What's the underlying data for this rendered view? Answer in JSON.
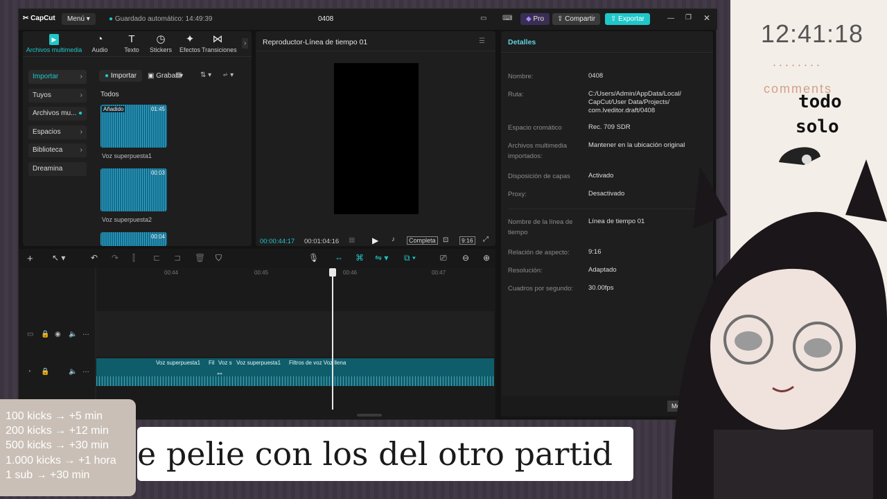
{
  "app": {
    "logo": "CapCut",
    "menu": "Menú",
    "autosave": "Guardado automático: 14:49:39",
    "project_title": "0408",
    "pro": "Pro",
    "share": "Compartir",
    "export": "Exportar"
  },
  "tools": [
    {
      "label": "Archivos multimedia",
      "icon": "media-icon"
    },
    {
      "label": "Audio",
      "icon": "audio-icon"
    },
    {
      "label": "Texto",
      "icon": "text-icon"
    },
    {
      "label": "Stickers",
      "icon": "sticker-icon"
    },
    {
      "label": "Efectos",
      "icon": "effects-icon"
    },
    {
      "label": "Transiciones",
      "icon": "transitions-icon"
    }
  ],
  "sidebar": {
    "items": [
      {
        "label": "Importar"
      },
      {
        "label": "Tuyos"
      },
      {
        "label": "Archivos mu..."
      },
      {
        "label": "Espacios"
      },
      {
        "label": "Biblioteca"
      },
      {
        "label": "Dreamina"
      }
    ]
  },
  "media_panel": {
    "import": "Importar",
    "record": "Grabar",
    "all": "Todos",
    "items": [
      {
        "name": "Voz superpuesta1",
        "badge": "Añadido",
        "duration": "01:45"
      },
      {
        "name": "Voz superpuesta2",
        "badge": "",
        "duration": "00:03"
      },
      {
        "name": "",
        "badge": "",
        "duration": "00:04"
      }
    ]
  },
  "player": {
    "title": "Reproductor-Línea de tiempo 01",
    "current_time": "00:00:44:17",
    "total_time": "00:01:04:16",
    "full_label": "Completa",
    "ratio_label": "9:16"
  },
  "details": {
    "title": "Detalles",
    "rows": [
      {
        "k": "Nombre:",
        "v": "0408"
      },
      {
        "k": "Ruta:",
        "v": "C:/Users/Admin/AppData/Local/\nCapCut/User Data/Projects/\ncom.lveditor.draft/0408"
      },
      {
        "k": "Espacio cromático",
        "v": "Rec. 709 SDR"
      },
      {
        "k": "Archivos multimedia\nimportados:",
        "v": "Mantener en la ubicación original"
      },
      {
        "k": "Disposición de capas",
        "v": "Activado"
      },
      {
        "k": "Proxy:",
        "v": "Desactivado"
      },
      {
        "k": "Nombre de la línea de\ntiempo",
        "v": "Línea de tiempo 01"
      },
      {
        "k": "Relación de aspecto:",
        "v": "9:16"
      },
      {
        "k": "Resolución:",
        "v": "Adaptado"
      },
      {
        "k": "Cuadros por segundo:",
        "v": "30.00fps"
      }
    ],
    "modify": "Modi"
  },
  "timeline": {
    "ruler": [
      "00:44",
      "00:45",
      "00:46",
      "00:47"
    ],
    "clip_labels": [
      "Voz superpuesta1",
      "Fil",
      "Voz s",
      "Voz superpuesta1",
      "Filtros de voz Voz llena"
    ]
  },
  "overlay": {
    "clock": "12:41:18",
    "dots": "• • • • • • • •",
    "comments": "comments",
    "todo": "todo",
    "solo": "solo",
    "kicks": [
      "100 kicks → +5 min",
      "200 kicks → +12 min",
      "500 kicks → +30 min",
      "1.000 kicks → +1 hora",
      "1 sub → +30 min"
    ],
    "caption": "e pelie con los del otro partid"
  },
  "colors": {
    "accent": "#1fc7c9",
    "bg": "#131313",
    "panel": "#1e1e1e"
  }
}
